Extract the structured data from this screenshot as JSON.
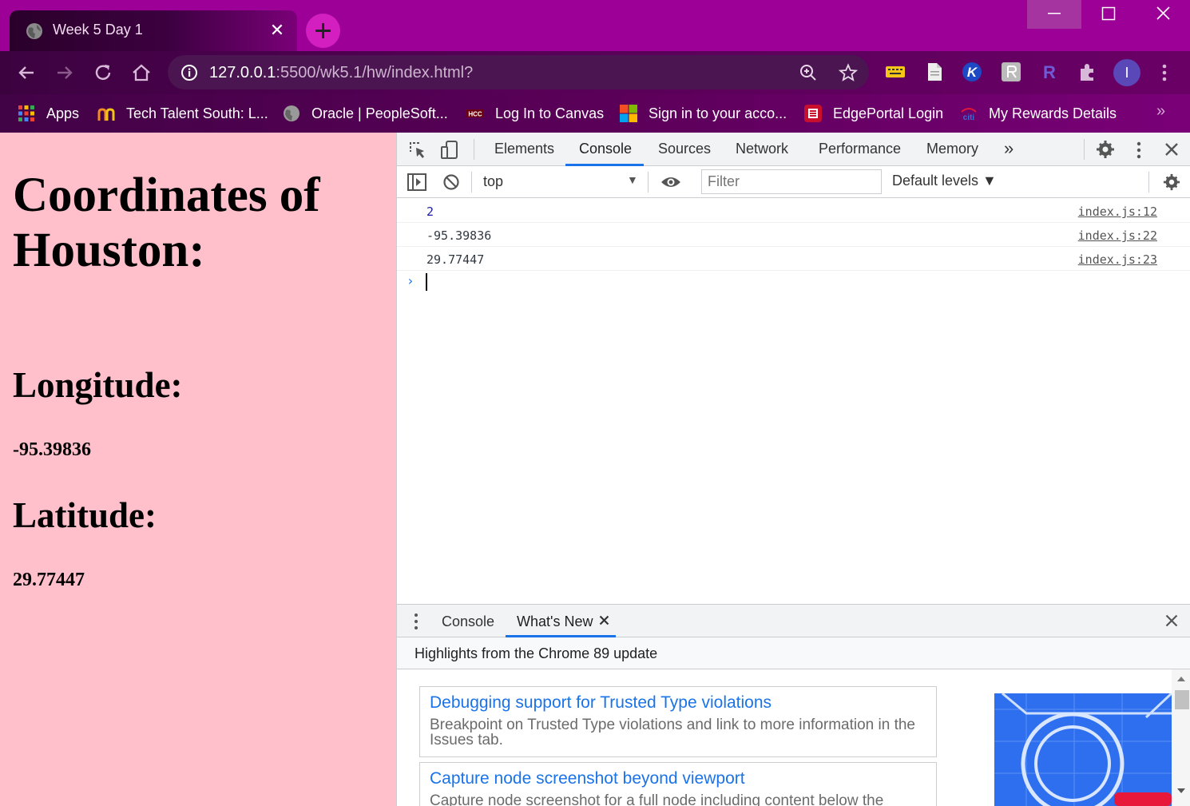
{
  "browser": {
    "tab_title": "Week 5 Day 1",
    "url_host": "127.0.0.1",
    "url_rest": ":5500/wk5.1/hw/index.html?",
    "avatar_letter": "I",
    "bookmarks": [
      {
        "label": "Apps",
        "icon": "apps-grid-icon"
      },
      {
        "label": "Tech Talent South: L...",
        "icon": "tech-talent-south-icon"
      },
      {
        "label": "Oracle | PeopleSoft...",
        "icon": "globe-icon"
      },
      {
        "label": "Log In to Canvas",
        "icon": "hcc-icon"
      },
      {
        "label": "Sign in to your acco...",
        "icon": "microsoft-icon"
      },
      {
        "label": "EdgePortal Login",
        "icon": "edgeportal-icon"
      },
      {
        "label": "My Rewards Details",
        "icon": "citi-icon"
      }
    ],
    "bookmarks_more": "»",
    "colors": {
      "frame": "#9c0096",
      "toolbar": "#550055",
      "accent": "#d31fbf"
    }
  },
  "page": {
    "heading": "Coordinates of Houston:",
    "longitude_label": "Longitude:",
    "longitude_value": "-95.39836",
    "latitude_label": "Latitude:",
    "latitude_value": "29.77447",
    "background": "#ffc0cb"
  },
  "devtools": {
    "tabs": [
      "Elements",
      "Console",
      "Sources",
      "Network",
      "Performance",
      "Memory"
    ],
    "more_tabs": "»",
    "active_tab": "Console",
    "context": "top",
    "filter_placeholder": "Filter",
    "levels": "Default levels ▼",
    "console_rows": [
      {
        "message": "2",
        "source": "index.js:12"
      },
      {
        "message": "-95.39836",
        "source": "index.js:22"
      },
      {
        "message": "29.77447",
        "source": "index.js:23"
      }
    ],
    "prompt": "›",
    "drawer": {
      "tabs": [
        "Console",
        "What's New"
      ],
      "active_tab": "What's New",
      "subtitle": "Highlights from the Chrome 89 update",
      "cards": [
        {
          "title": "Debugging support for Trusted Type violations",
          "desc": "Breakpoint on Trusted Type violations and link to more information in the Issues tab."
        },
        {
          "title": "Capture node screenshot beyond viewport",
          "desc": "Capture node screenshot for a full node including content below the"
        }
      ]
    }
  }
}
